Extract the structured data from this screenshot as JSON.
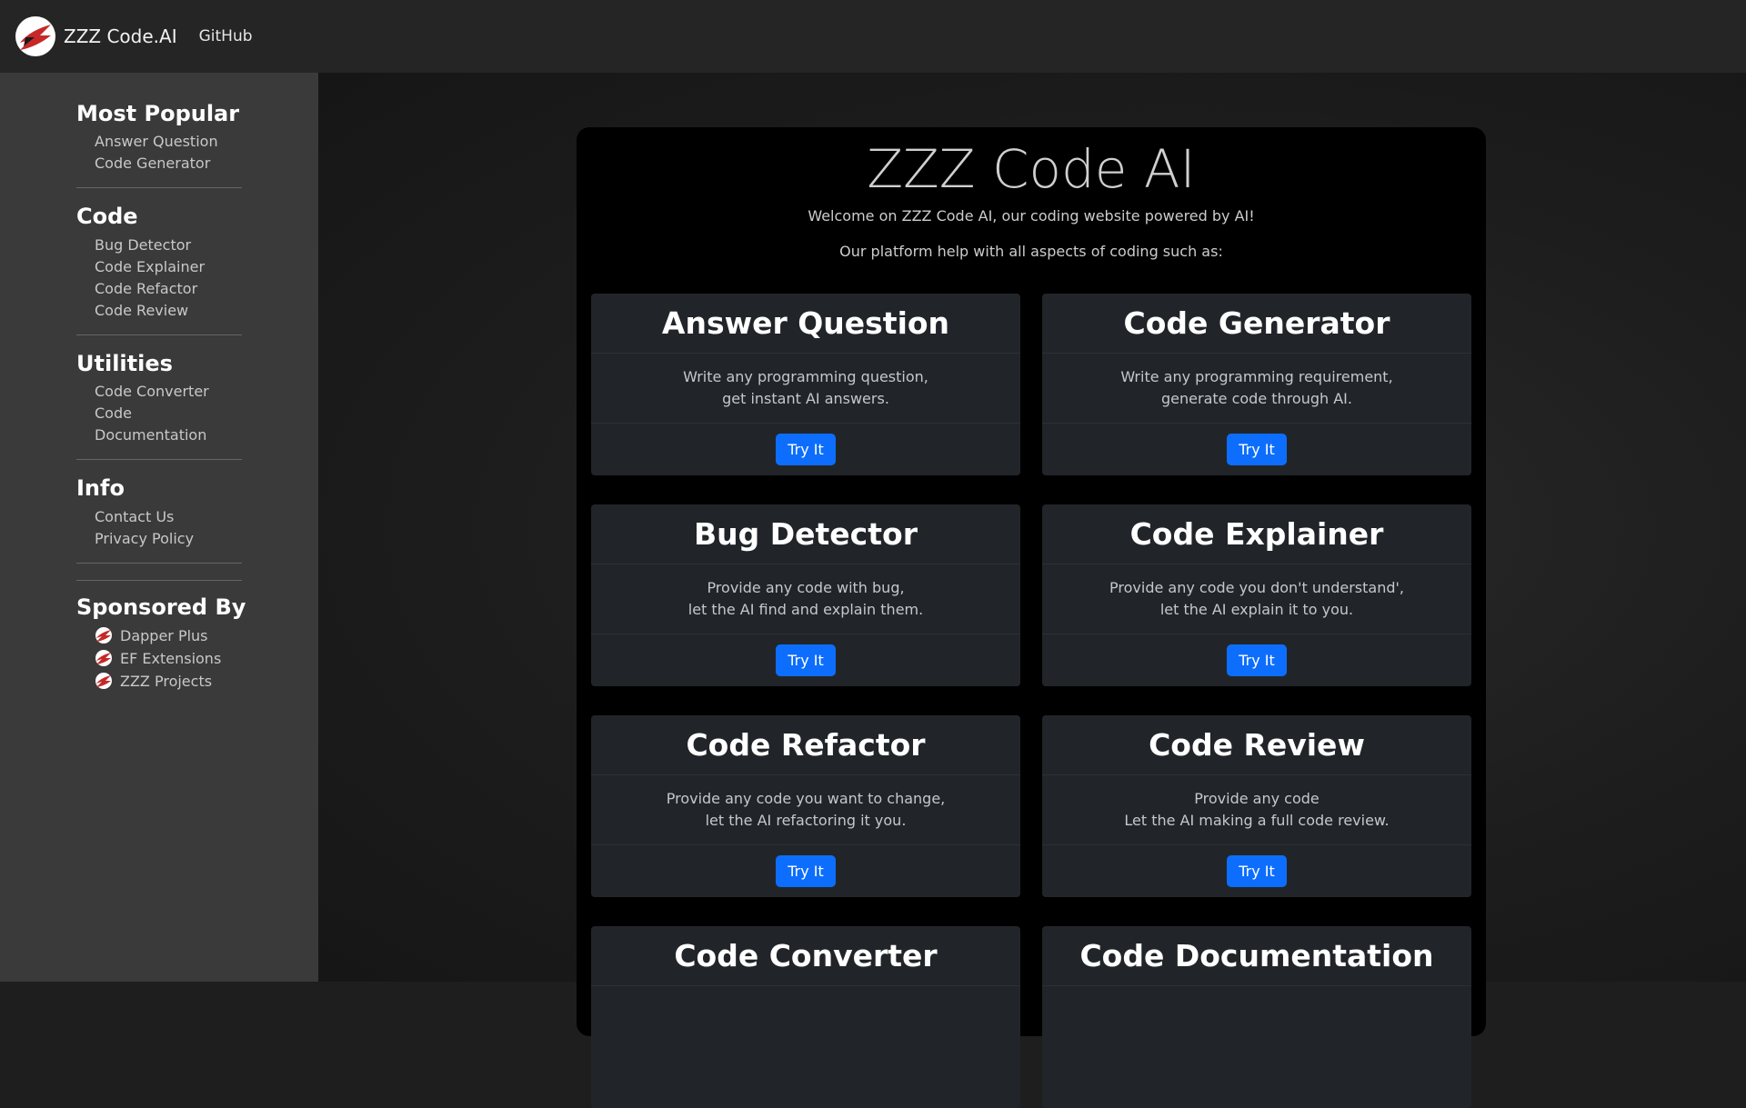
{
  "navbar": {
    "brand": "ZZZ Code.AI",
    "github": "GitHub"
  },
  "sidebar": {
    "sections": [
      {
        "title": "Most Popular",
        "items": [
          "Answer Question",
          "Code Generator"
        ]
      },
      {
        "title": "Code",
        "items": [
          "Bug Detector",
          "Code Explainer",
          "Code Refactor",
          "Code Review"
        ]
      },
      {
        "title": "Utilities",
        "items": [
          "Code Converter",
          "Code Documentation"
        ]
      },
      {
        "title": "Info",
        "items": [
          "Contact Us",
          "Privacy Policy"
        ]
      }
    ],
    "sponsored": {
      "title": "Sponsored By",
      "items": [
        "Dapper Plus",
        "EF Extensions",
        "ZZZ Projects"
      ]
    }
  },
  "main": {
    "title": "ZZZ Code AI",
    "welcome": "Welcome on ZZZ Code AI, our coding website powered by AI!",
    "platform": "Our platform help with all aspects of coding such as:",
    "cards": [
      {
        "title": "Answer Question",
        "line1": "Write any programming question,",
        "line2": "get instant AI answers.",
        "button": "Try It"
      },
      {
        "title": "Code Generator",
        "line1": "Write any programming requirement,",
        "line2": "generate code through AI.",
        "button": "Try It"
      },
      {
        "title": "Bug Detector",
        "line1": "Provide any code with bug,",
        "line2": "let the AI find and explain them.",
        "button": "Try It"
      },
      {
        "title": "Code Explainer",
        "line1": "Provide any code you don't understand',",
        "line2": "let the AI explain it to you.",
        "button": "Try It"
      },
      {
        "title": "Code Refactor",
        "line1": "Provide any code you want to change,",
        "line2": "let the AI refactoring it you.",
        "button": "Try It"
      },
      {
        "title": "Code Review",
        "line1": "Provide any code",
        "line2": "Let the AI making a full code review.",
        "button": "Try It"
      },
      {
        "title": "Code Converter",
        "line1": "",
        "line2": "",
        "button": ""
      },
      {
        "title": "Code Documentation",
        "line1": "",
        "line2": "",
        "button": ""
      }
    ]
  },
  "colors": {
    "accent": "#0d6efd",
    "logo_red": "#d32f2f"
  }
}
